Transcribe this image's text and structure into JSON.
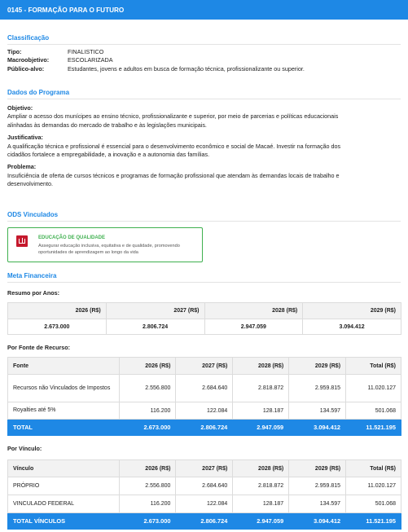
{
  "header": {
    "title": "0145 - FORMAÇÃO PARA O FUTURO"
  },
  "classificacao": {
    "title": "Classificação",
    "tipo_label": "Tipo:",
    "tipo": "FINALISTICO",
    "macro_label": "Macroobjetivo:",
    "macro": "ESCOLARIZADA",
    "publico_label": "Público-alvo:",
    "publico": "Estudantes, jovens e adultos em busca de formação técnica, profissionalizante ou superior."
  },
  "dados": {
    "title": "Dados do Programa",
    "objetivo_label": "Objetivo:",
    "objetivo_l1": "Ampliar o acesso dos munícipes ao ensino técnico, profissionalizante e superior, por meio de parcerias e políticas educacionais",
    "objetivo_l2": "alinhadas às demandas do mercado de trabalho e às legislações municipais.",
    "justificativa_label": "Justificativa:",
    "justificativa_l1": "A qualificação técnica e profissional é essencial para o desenvolvimento econômico e social de Macaé. Investir na formação dos",
    "justificativa_l2": "cidadãos fortalece a empregabilidade, a inovação e a autonomia das famílias.",
    "problema_label": "Problema:",
    "problema_l1": "Insuficiência de oferta de cursos técnicos e programas de formação profissional que atendam às demandas locais de trabalho e",
    "problema_l2": "desenvolvimento."
  },
  "ods": {
    "title": "ODS Vinculados",
    "card_title": "EDUCAÇÃO DE QUALIDADE",
    "card_desc_l1": "Assegurar educação inclusiva, equitativa e de qualidade, promovendo",
    "card_desc_l2": "oportunidades de aprendizagem ao longo da vida",
    "color": "#c5192d"
  },
  "meta": {
    "title": "Meta Financeira",
    "resumo_label": "Resumo por Anos:",
    "resumo_headers": [
      "2026 (R$)",
      "2027 (R$)",
      "2028 (R$)",
      "2029 (R$)"
    ],
    "resumo_values": [
      "2.673.000",
      "2.806.724",
      "2.947.059",
      "3.094.412"
    ],
    "fonte_label": "Por Fonte de Recurso:",
    "fonte_headers": [
      "Fonte",
      "2026 (R$)",
      "2027 (R$)",
      "2028 (R$)",
      "2029 (R$)",
      "Total (R$)"
    ],
    "fonte_rows": [
      [
        "Recursos não Vinculados de Impostos",
        "2.556.800",
        "2.684.640",
        "2.818.872",
        "2.959.815",
        "11.020.127"
      ],
      [
        "Royalties até 5%",
        "116.200",
        "122.084",
        "128.187",
        "134.597",
        "501.068"
      ]
    ],
    "fonte_total": [
      "TOTAL",
      "2.673.000",
      "2.806.724",
      "2.947.059",
      "3.094.412",
      "11.521.195"
    ],
    "vinculo_label": "Por Vínculo:",
    "vinculo_headers": [
      "Vínculo",
      "2026 (R$)",
      "2027 (R$)",
      "2028 (R$)",
      "2029 (R$)",
      "Total (R$)"
    ],
    "vinculo_rows": [
      [
        "PRÓPRIO",
        "2.556.800",
        "2.684.640",
        "2.818.872",
        "2.959.815",
        "11.020.127"
      ],
      [
        "VINCULADO FEDERAL",
        "116.200",
        "122.084",
        "128.187",
        "134.597",
        "501.068"
      ]
    ],
    "vinculo_total": [
      "TOTAL VÍNCULOS",
      "2.673.000",
      "2.806.724",
      "2.947.059",
      "3.094.412",
      "11.521.195"
    ]
  },
  "colors": {
    "accent": "#1e88e5",
    "ods_green": "#3fb04f"
  }
}
